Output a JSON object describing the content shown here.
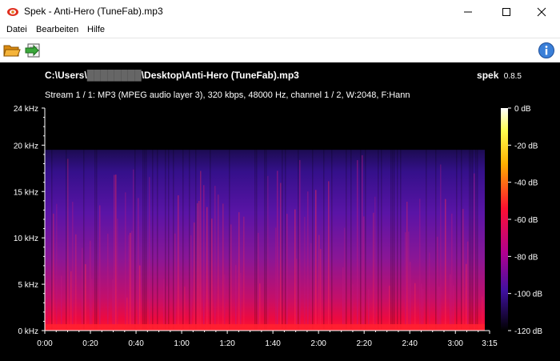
{
  "window": {
    "title": "Spek - Anti-Hero (TuneFab).mp3"
  },
  "menu": {
    "items": [
      "Datei",
      "Bearbeiten",
      "Hilfe"
    ]
  },
  "toolbar": {
    "open_icon": "folder-open-icon",
    "save_icon": "save-icon",
    "info_icon": "info-icon"
  },
  "file": {
    "path_start": "C:\\Users\\",
    "path_end": "\\Desktop\\Anti-Hero (TuneFab).mp3",
    "stream_info": "Stream 1 / 1: MP3 (MPEG audio layer 3), 320 kbps, 48000 Hz, channel 1 / 2, W:2048, F:Hann"
  },
  "app": {
    "name": "spek",
    "version": "0.8.5"
  },
  "chart_data": {
    "type": "heatmap",
    "title": "",
    "ylabel": "",
    "xlabel": "",
    "y_ticks": [
      "0 kHz",
      "5 kHz",
      "10 kHz",
      "15 kHz",
      "20 kHz",
      "24 kHz"
    ],
    "y_values_khz": [
      0,
      5,
      10,
      15,
      20,
      24
    ],
    "ylim_khz": [
      0,
      24
    ],
    "x_ticks": [
      "0:00",
      "0:20",
      "0:40",
      "1:00",
      "1:20",
      "1:40",
      "2:00",
      "2:20",
      "2:40",
      "3:00",
      "3:15"
    ],
    "x_values_sec": [
      0,
      20,
      40,
      60,
      80,
      100,
      120,
      140,
      160,
      180,
      195
    ],
    "xlim_sec": [
      0,
      195
    ],
    "duration_sec": 195,
    "cutoff_khz": 19.5,
    "colorbar": {
      "labels": [
        "0 dB",
        "-20 dB",
        "-40 dB",
        "-60 dB",
        "-80 dB",
        "-100 dB",
        "-120 dB"
      ],
      "values_db": [
        0,
        -20,
        -40,
        -60,
        -80,
        -100,
        -120
      ],
      "range_db": [
        -120,
        0
      ],
      "colors": [
        "#ffffff",
        "#ffff40",
        "#ffa000",
        "#ff1030",
        "#b00090",
        "#4010a0",
        "#000000"
      ]
    }
  }
}
